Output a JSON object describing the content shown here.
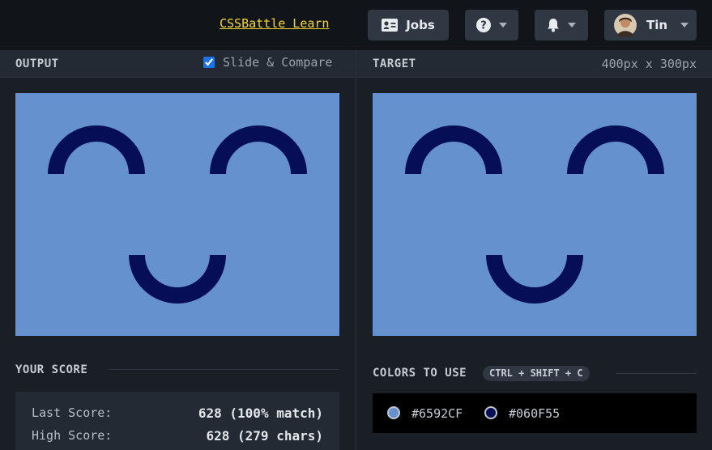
{
  "header": {
    "learn_link": "CSSBattle Learn",
    "jobs_label": "Jobs",
    "user_name": "Tin"
  },
  "output_panel": {
    "title": "OUTPUT",
    "slide_compare_label": "Slide & Compare",
    "slide_compare_checked": true
  },
  "target_panel": {
    "title": "TARGET",
    "dimensions": "400px x 300px"
  },
  "score": {
    "title": "YOUR SCORE",
    "last_label": "Last Score:",
    "last_value": "628 (100% match)",
    "high_label": "High Score:",
    "high_value": "628 (279 chars)"
  },
  "colors": {
    "title": "COLORS TO USE",
    "shortcut": "CTRL + SHIFT + C",
    "items": [
      {
        "hex": "#6592CF",
        "color": "#6592cf"
      },
      {
        "hex": "#060F55",
        "color": "#060f55"
      }
    ]
  },
  "canvas": {
    "background": "#6592cf",
    "shape_color": "#060f55"
  }
}
